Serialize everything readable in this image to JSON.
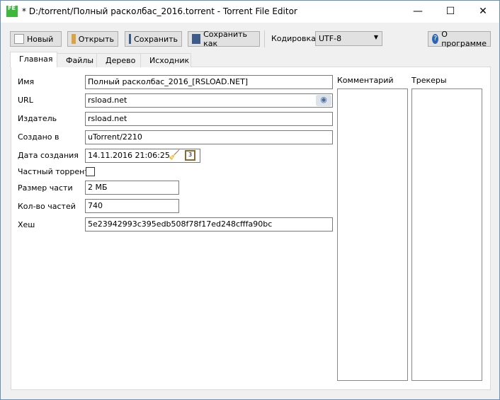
{
  "window": {
    "title": "* D:/torrent/Полный расколбас_2016.torrent - Torrent File Editor",
    "app_icon_text": "FE",
    "minimize": "—",
    "maximize": "☐",
    "close": "✕"
  },
  "toolbar": {
    "new": "Новый",
    "open": "Открыть",
    "save": "Сохранить",
    "save_as": "Сохранить как",
    "encoding_label": "Кодировка",
    "encoding_value": "UTF-8",
    "about": "О программе"
  },
  "tabs": [
    "Главная",
    "Файлы",
    "Дерево",
    "Исходник"
  ],
  "main": {
    "name_label": "Имя",
    "name_value": "Полный расколбас_2016_[RSLOAD.NET]",
    "url_label": "URL",
    "url_value": "rsload.net",
    "publisher_label": "Издатель",
    "publisher_value": "rsload.net",
    "created_by_label": "Создано в",
    "created_by_value": "uTorrent/2210",
    "date_label": "Дата создания",
    "date_value": "14.11.2016 21:06:25",
    "private_label": "Частный торрент",
    "private_checked": false,
    "piece_size_label": "Размер части",
    "piece_size_value": "2 МБ",
    "pieces_label": "Кол-во частей",
    "pieces_value": "740",
    "hash_label": "Хеш",
    "hash_value": "5e23942993c395edb508f78f17ed248cfffa90bc",
    "comment_label": "Комментарий",
    "trackers_label": "Трекеры"
  }
}
